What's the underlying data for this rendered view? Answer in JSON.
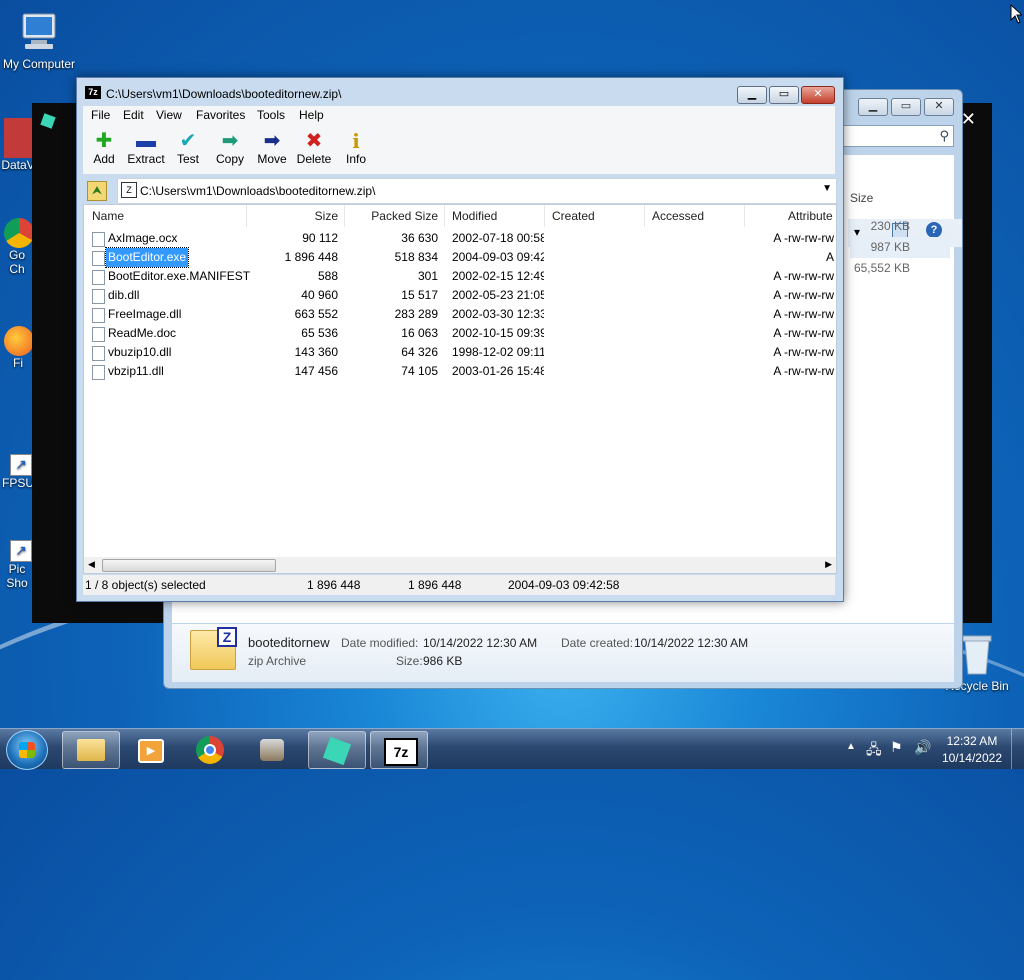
{
  "desktop": {
    "icons": [
      {
        "label": "My Computer"
      },
      {
        "label": "DataV"
      },
      {
        "label": "Go Ch"
      },
      {
        "label": "Fi"
      },
      {
        "label": "FPSU"
      },
      {
        "label": "Pic Sho"
      },
      {
        "label": "Recycle Bin"
      }
    ]
  },
  "explorer": {
    "sizes": [
      "230 KB",
      "987 KB",
      "65,552 KB"
    ],
    "size_header": "Size",
    "details": {
      "name": "booteditornew",
      "type": "zip Archive",
      "date_modified_label": "Date modified:",
      "date_modified": "10/14/2022 12:30 AM",
      "date_created_label": "Date created:",
      "date_created": "10/14/2022 12:30 AM",
      "size_label": "Size:",
      "size": "986 KB"
    }
  },
  "sevenzip": {
    "title": "C:\\Users\\vm1\\Downloads\\booteditornew.zip\\",
    "menu": [
      "File",
      "Edit",
      "View",
      "Favorites",
      "Tools",
      "Help"
    ],
    "toolbar": [
      {
        "label": "Add",
        "icon": "add-icon",
        "glyph": "✚",
        "color": "#22a822"
      },
      {
        "label": "Extract",
        "icon": "extract-icon",
        "glyph": "▬",
        "color": "#1f3fa8"
      },
      {
        "label": "Test",
        "icon": "test-icon",
        "glyph": "✔",
        "color": "#17a7b5"
      },
      {
        "label": "Copy",
        "icon": "copy-icon",
        "glyph": "➡",
        "color": "#1e9a7a"
      },
      {
        "label": "Move",
        "icon": "move-icon",
        "glyph": "➡",
        "color": "#1a2f8a"
      },
      {
        "label": "Delete",
        "icon": "delete-icon",
        "glyph": "✖",
        "color": "#d01f1f"
      },
      {
        "label": "Info",
        "icon": "info-icon",
        "glyph": "i",
        "color": "#c79a00"
      }
    ],
    "address": "C:\\Users\\vm1\\Downloads\\booteditornew.zip\\",
    "columns": [
      "Name",
      "Size",
      "Packed Size",
      "Modified",
      "Created",
      "Accessed",
      "Attribute"
    ],
    "files": [
      {
        "name": "AxImage.ocx",
        "size": "90 112",
        "packed": "36 630",
        "modified": "2002-07-18 00:58",
        "attr": "A -rw-rw-rw"
      },
      {
        "name": "BootEditor.exe",
        "size": "1 896 448",
        "packed": "518 834",
        "modified": "2004-09-03 09:42",
        "attr": "A",
        "selected": true
      },
      {
        "name": "BootEditor.exe.MANIFEST",
        "size": "588",
        "packed": "301",
        "modified": "2002-02-15 12:49",
        "attr": "A -rw-rw-rw"
      },
      {
        "name": "dib.dll",
        "size": "40 960",
        "packed": "15 517",
        "modified": "2002-05-23 21:05",
        "attr": "A -rw-rw-rw"
      },
      {
        "name": "FreeImage.dll",
        "size": "663 552",
        "packed": "283 289",
        "modified": "2002-03-30 12:33",
        "attr": "A -rw-rw-rw"
      },
      {
        "name": "ReadMe.doc",
        "size": "65 536",
        "packed": "16 063",
        "modified": "2002-10-15 09:39",
        "attr": "A -rw-rw-rw"
      },
      {
        "name": "vbuzip10.dll",
        "size": "143 360",
        "packed": "64 326",
        "modified": "1998-12-02 09:11",
        "attr": "A -rw-rw-rw"
      },
      {
        "name": "vbzip11.dll",
        "size": "147 456",
        "packed": "74 105",
        "modified": "2003-01-26 15:48",
        "attr": "A -rw-rw-rw"
      }
    ],
    "status": {
      "selection": "1 / 8 object(s) selected",
      "size": "1 896 448",
      "packed": "1 896 448",
      "modified": "2004-09-03 09:42:58"
    }
  },
  "taskbar": {
    "time": "12:32 AM",
    "date": "10/14/2022"
  }
}
